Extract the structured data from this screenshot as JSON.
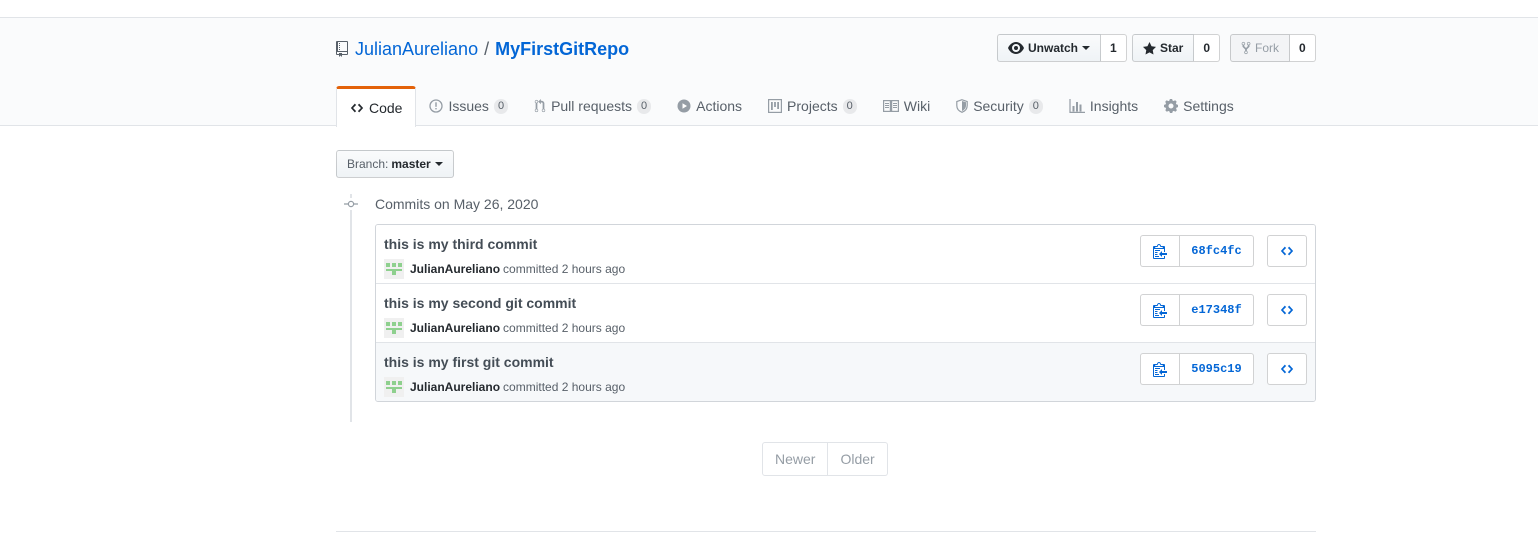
{
  "repo": {
    "owner": "JulianAureliano",
    "separator": "/",
    "name": "MyFirstGitRepo"
  },
  "actions": {
    "watch": {
      "label": "Unwatch",
      "count": "1"
    },
    "star": {
      "label": "Star",
      "count": "0"
    },
    "fork": {
      "label": "Fork",
      "count": "0"
    }
  },
  "tabs": [
    {
      "label": "Code",
      "icon": "code-icon",
      "counter": null,
      "selected": true
    },
    {
      "label": "Issues",
      "icon": "issue-icon",
      "counter": "0"
    },
    {
      "label": "Pull requests",
      "icon": "pull-request-icon",
      "counter": "0"
    },
    {
      "label": "Actions",
      "icon": "play-icon",
      "counter": null
    },
    {
      "label": "Projects",
      "icon": "project-icon",
      "counter": "0"
    },
    {
      "label": "Wiki",
      "icon": "book-icon",
      "counter": null
    },
    {
      "label": "Security",
      "icon": "shield-icon",
      "counter": "0"
    },
    {
      "label": "Insights",
      "icon": "graph-icon",
      "counter": null
    },
    {
      "label": "Settings",
      "icon": "gear-icon",
      "counter": null
    }
  ],
  "branch": {
    "prefix": "Branch:",
    "name": "master"
  },
  "commit_group": {
    "title": "Commits on May 26, 2020"
  },
  "commits": [
    {
      "message": "this is my third commit",
      "author": "JulianAureliano",
      "action": "committed",
      "time": "2 hours ago",
      "sha": "68fc4fc"
    },
    {
      "message": "this is my second git commit",
      "author": "JulianAureliano",
      "action": "committed",
      "time": "2 hours ago",
      "sha": "e17348f"
    },
    {
      "message": "this is my first git commit",
      "author": "JulianAureliano",
      "action": "committed",
      "time": "2 hours ago",
      "sha": "5095c19"
    }
  ],
  "pagination": {
    "newer": "Newer",
    "older": "Older"
  },
  "colors": {
    "link": "#0366d6",
    "tab_accent": "#e36209",
    "avatar": "#8ed08e"
  }
}
